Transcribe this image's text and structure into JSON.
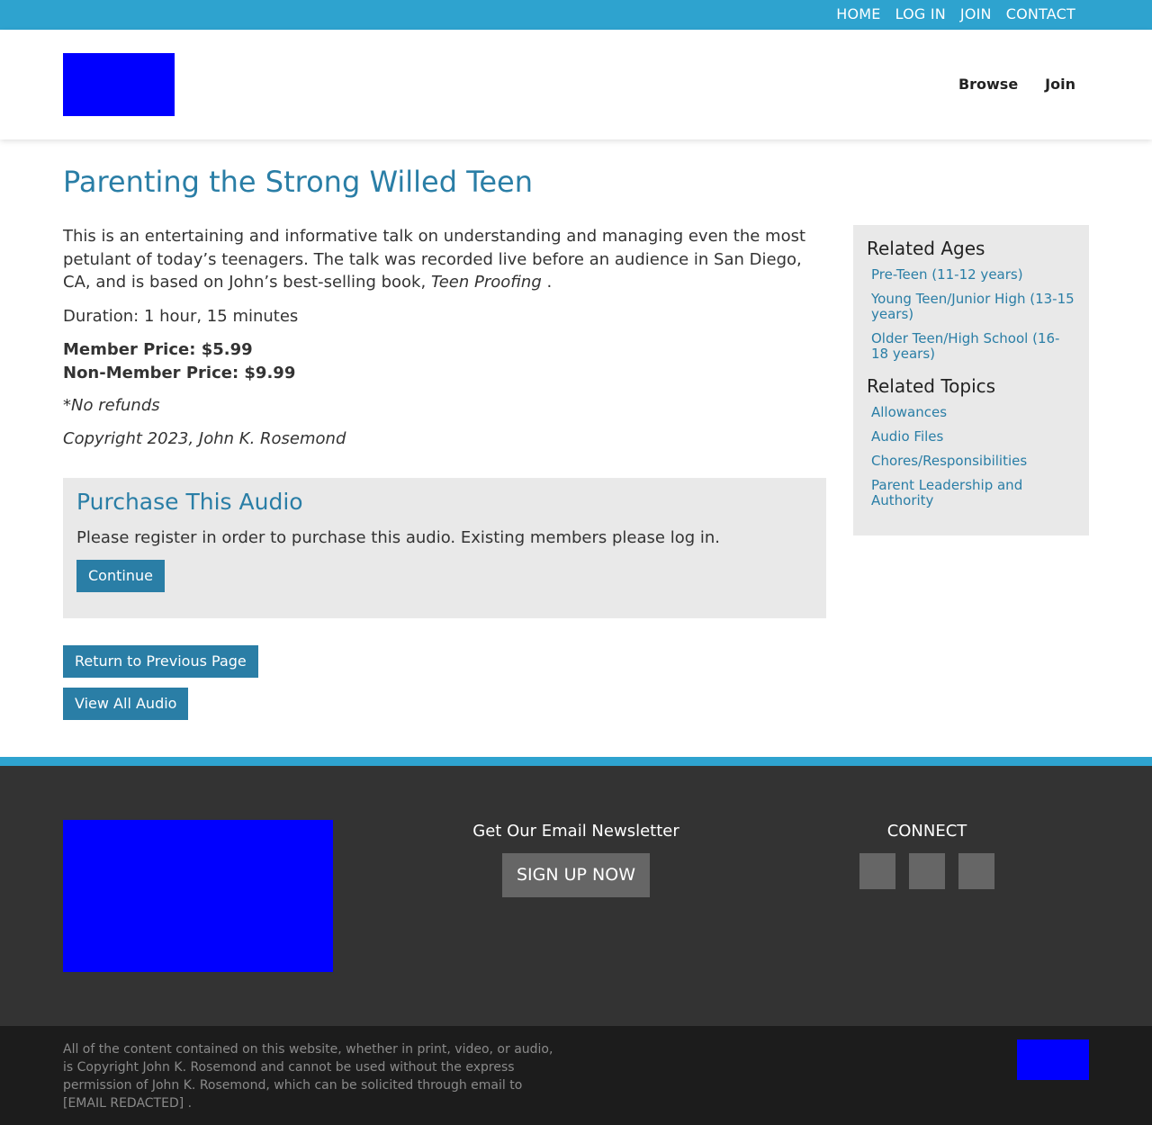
{
  "topbar": {
    "links": [
      "HOME",
      "LOG IN",
      "JOIN",
      "CONTACT"
    ]
  },
  "header": {
    "nav": [
      "Browse",
      "Join"
    ]
  },
  "page": {
    "title": "Parenting the Strong Willed Teen",
    "description_text": "This is an entertaining and informative talk on understanding and managing even the most petulant of today’s teenagers. The talk was recorded live before an audience in San Diego, CA, and is based on John’s best-selling book,",
    "book_title": "Teen Proofing",
    "description_end": ".",
    "duration": "Duration: 1 hour, 15 minutes",
    "member_price": "Member Price: $5.99",
    "non_member_price": "Non-Member Price: $9.99",
    "no_refunds": "*No refunds",
    "copyright": "Copyright 2023, John K. Rosemond"
  },
  "purchase": {
    "title": "Purchase This Audio",
    "text": "Please register in order to purchase this audio. Existing members please log in.",
    "continue_label": "Continue"
  },
  "actions": {
    "return_label": "Return to Previous Page",
    "view_all_label": "View All Audio"
  },
  "sidebar": {
    "ages_heading": "Related Ages",
    "ages": [
      "Pre-Teen (11-12 years)",
      "Young Teen/Junior High (13-15 years)",
      "Older Teen/High School (16-18 years)"
    ],
    "topics_heading": "Related Topics",
    "topics": [
      "Allowances",
      "Audio Files",
      "Chores/Responsibilities",
      "Parent Leadership and Authority"
    ]
  },
  "footer": {
    "newsletter_title": "Get Our Email Newsletter",
    "signup_label": "SIGN UP NOW",
    "connect_title": "CONNECT",
    "social_icons": [
      "facebook-icon",
      "twitter-icon",
      "instagram-icon"
    ],
    "social_glyphs": [
      "",
      "",
      ""
    ],
    "legal": "All of the content contained on this website, whether in print, video, or audio, is Copyright John K. Rosemond and cannot be used without the express permission of John K. Rosemond, which can be solicited through email to [EMAIL REDACTED] ."
  }
}
